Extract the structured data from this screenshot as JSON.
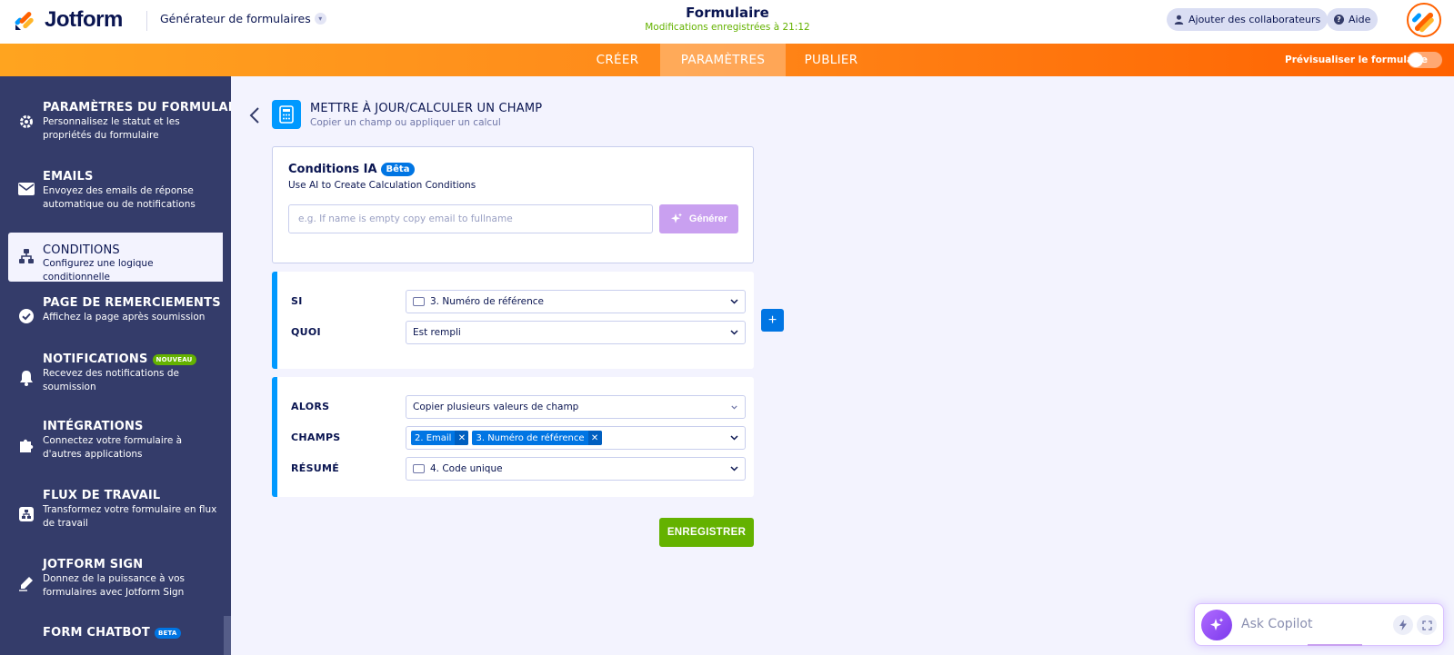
{
  "header": {
    "logo_text": "Jotform",
    "builder_name": "Générateur de formulaires",
    "form_title": "Formulaire",
    "save_status": "Modifications enregistrées à 21:12",
    "collaborators_label": "Ajouter des collaborateurs",
    "help_label": "Aide"
  },
  "nav": {
    "tabs": [
      {
        "label": "CRÉER",
        "active": false
      },
      {
        "label": "PARAMÈTRES",
        "active": true
      },
      {
        "label": "PUBLIER",
        "active": false
      }
    ],
    "preview_label": "Prévisualiser le formulaire"
  },
  "sidebar": {
    "items": [
      {
        "title": "PARAMÈTRES DU FORMULAI...",
        "desc": "Personnalisez le statut et les propriétés du formulaire",
        "icon": "gear-icon"
      },
      {
        "title": "EMAILS",
        "desc": "Envoyez des emails de réponse automatique ou de notifications",
        "icon": "envelope-icon"
      },
      {
        "title": "CONDITIONS",
        "desc": "Configurez une logique conditionnelle",
        "icon": "conditions-icon",
        "active": true
      },
      {
        "title": "PAGE DE REMERCIEMENTS",
        "desc": "Affichez la page après soumission",
        "icon": "check-circle-icon"
      },
      {
        "title": "NOTIFICATIONS",
        "badge": "NOUVEAU",
        "desc": "Recevez des notifications de soumission",
        "icon": "bell-icon"
      },
      {
        "title": "INTÉGRATIONS",
        "desc": "Connectez votre formulaire à d'autres applications",
        "icon": "puzzle-icon"
      },
      {
        "title": "FLUX DE TRAVAIL",
        "desc": "Transformez votre formulaire en flux de travail",
        "icon": "workflow-icon"
      },
      {
        "title": "JOTFORM SIGN",
        "desc": "Donnez de la puissance à vos formulaires avec Jotform Sign",
        "icon": "pen-icon"
      },
      {
        "title": "FORM CHATBOT",
        "badge": "BETA",
        "desc": "",
        "icon": "chatbot-icon"
      }
    ]
  },
  "page": {
    "title": "METTRE À JOUR/CALCULER UN CHAMP",
    "subtitle": "Copier un champ ou appliquer un calcul"
  },
  "ai": {
    "title": "Conditions IA",
    "badge": "Bêta",
    "subtitle": "Use AI to Create Calculation Conditions",
    "placeholder": "e.g. If name is empty copy email to fullname",
    "generate_label": "Générer"
  },
  "condition": {
    "if_label": "SI",
    "if_value": "3. Numéro de référence",
    "what_label": "QUOI",
    "what_value": "Est rempli"
  },
  "action": {
    "then_label": "ALORS",
    "then_value": "Copier plusieurs valeurs de champ",
    "fields_label": "CHAMPS",
    "fields_tags": [
      "2. Email",
      "3. Numéro de référence"
    ],
    "summary_label": "RÉSUMÉ",
    "summary_value": "4. Code unique"
  },
  "buttons": {
    "add": "+",
    "save": "ENREGISTRER"
  },
  "copilot": {
    "placeholder": "Ask Copilot"
  },
  "colors": {
    "brand_orange": "#ff6100",
    "navy": "#0a1551",
    "sidebar_bg": "#343c6a",
    "accent_blue": "#0099ff",
    "save_green": "#64b200",
    "ai_purple": "#c9a0f0"
  }
}
